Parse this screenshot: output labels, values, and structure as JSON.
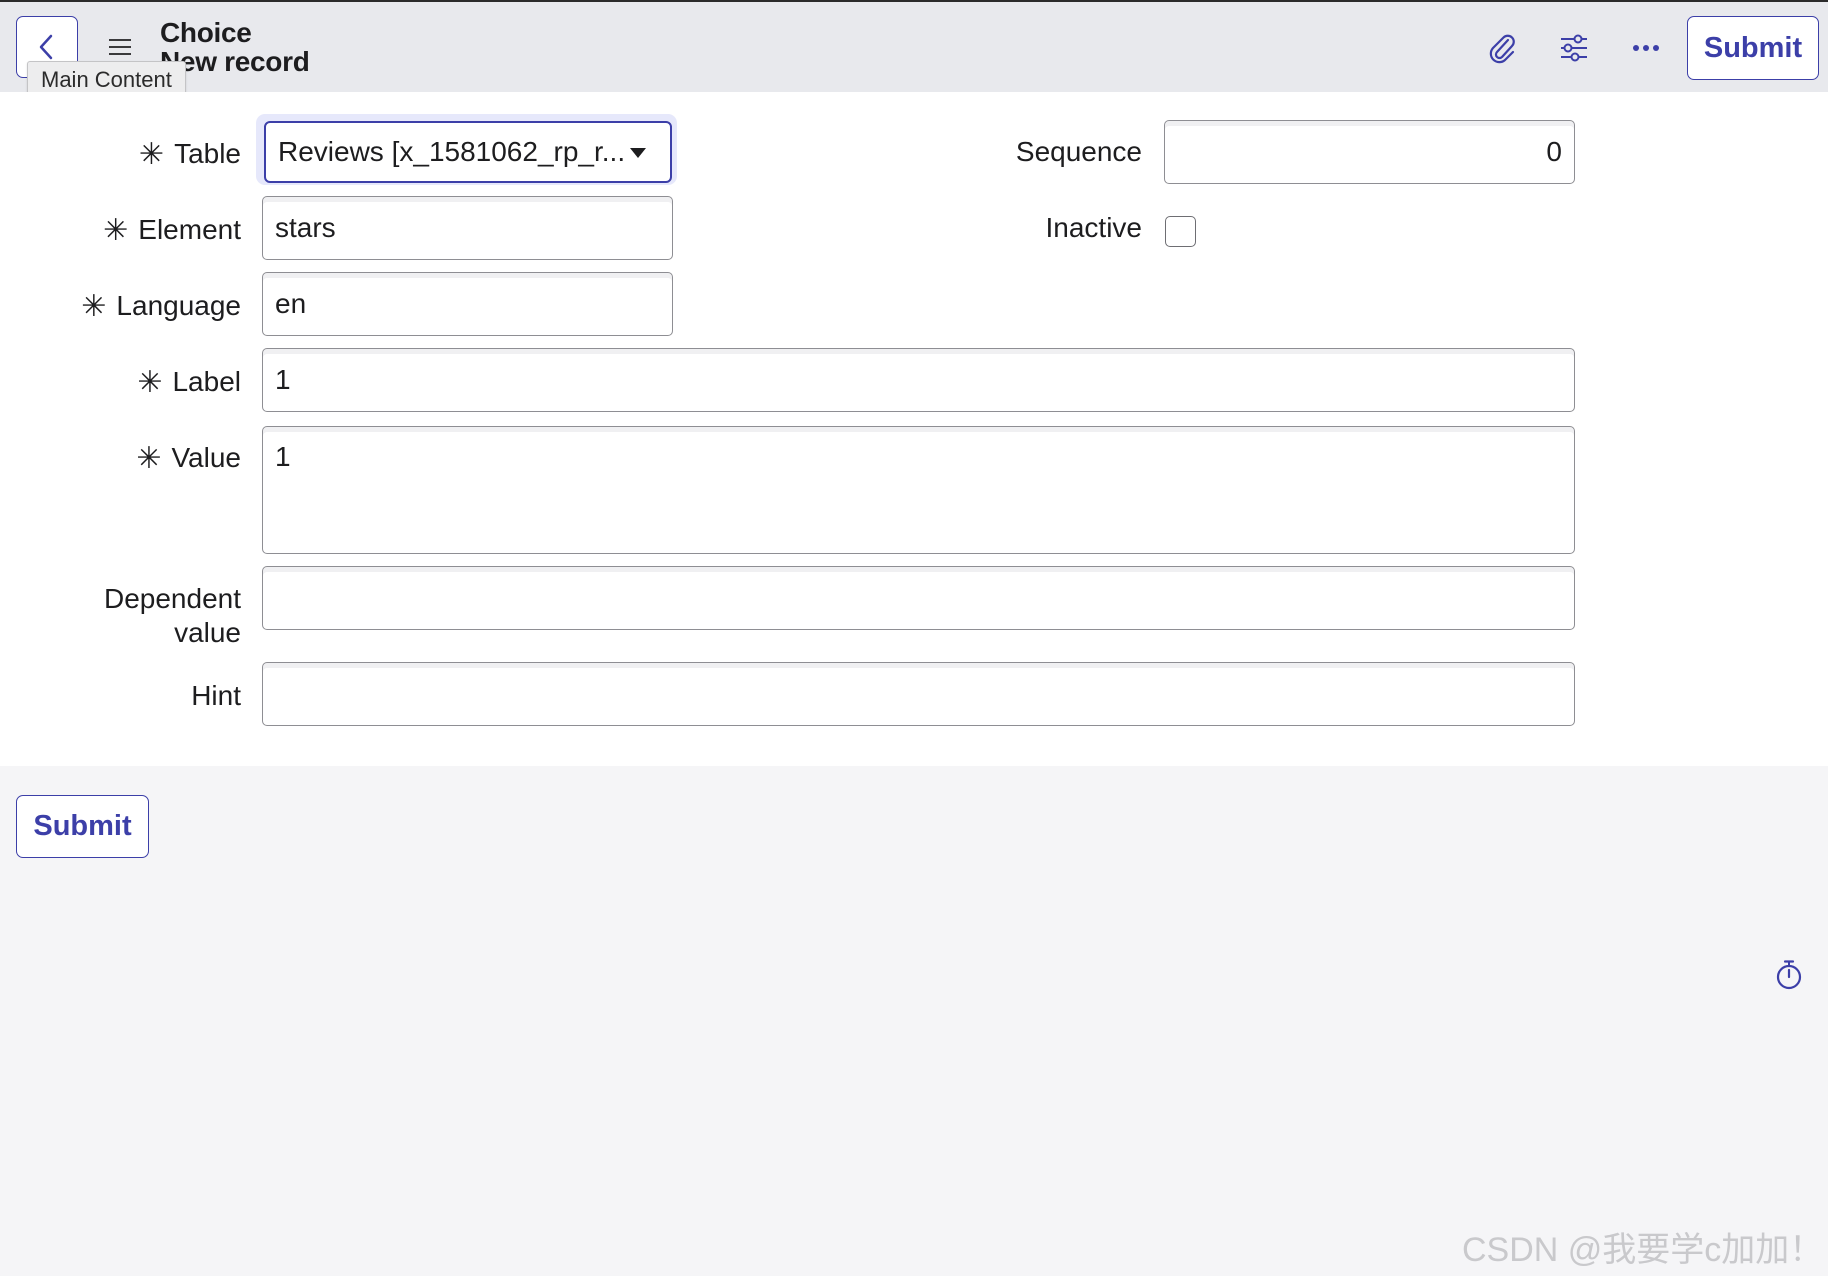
{
  "header": {
    "title": "Choice",
    "subtitle": "New record",
    "tooltip": "Main Content",
    "submit_label": "Submit",
    "icons": [
      "chevron-left-icon",
      "hamburger-menu-icon",
      "paperclip-icon",
      "sliders-icon",
      "more-horizontal-icon"
    ]
  },
  "form": {
    "table": {
      "label": "Table",
      "required": true,
      "value": "Reviews [x_1581062_rp_r..."
    },
    "element": {
      "label": "Element",
      "required": true,
      "value": "stars"
    },
    "language": {
      "label": "Language",
      "required": true,
      "value": "en"
    },
    "label": {
      "label": "Label",
      "required": true,
      "value": "1"
    },
    "value": {
      "label": "Value",
      "required": true,
      "value": "1"
    },
    "dependent_value": {
      "label_line1": "Dependent",
      "label_line2": "value",
      "value": ""
    },
    "hint": {
      "label": "Hint",
      "value": ""
    },
    "sequence": {
      "label": "Sequence",
      "value": "0"
    },
    "inactive": {
      "label": "Inactive",
      "checked": false
    },
    "required_marker": "✳"
  },
  "footer": {
    "submit_label": "Submit",
    "timer_icon": "stopwatch-icon"
  },
  "watermark": "CSDN @我要学c加加！",
  "colors": {
    "accent": "#3c3fa8",
    "header_bg": "#e8e9ed",
    "page_bg": "#f5f5f7"
  }
}
